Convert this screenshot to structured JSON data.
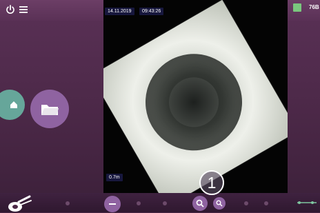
{
  "header": {
    "power_icon": "power-icon",
    "menu_icon": "hamburger-menu-icon",
    "right_value": "76B"
  },
  "overlay": {
    "date": "14.11.2019",
    "time": "09:43:26",
    "distance": "0.7m",
    "callout_number": "1"
  },
  "controls": {
    "home_icon": "home-icon",
    "folder_icon": "folder-icon",
    "minus_icon": "minus-icon",
    "zoom_in_icon": "zoom-in-icon",
    "zoom_out_icon": "zoom-out-icon",
    "camera_icon": "camera-probe-icon",
    "line_icon": "line-slider-icon"
  },
  "colors": {
    "panel": "#4b2846",
    "panel_light": "#5a3156",
    "accent_purple": "#8f63a1",
    "teal": "#66a69a",
    "green_slider": "#7fc7a0"
  }
}
